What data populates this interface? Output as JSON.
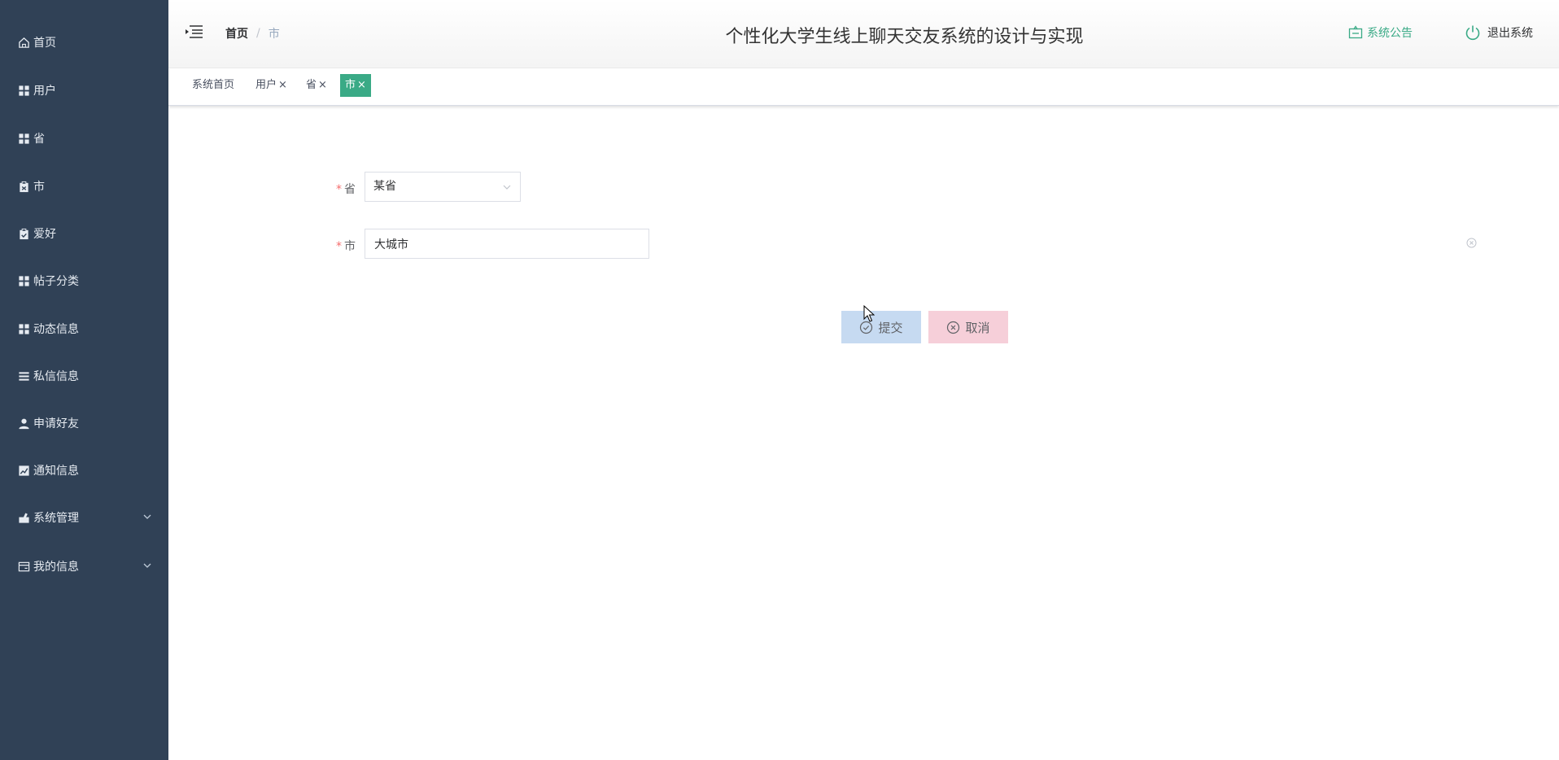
{
  "sidebar": {
    "items": [
      {
        "label": "首页",
        "icon": "home-icon"
      },
      {
        "label": "用户",
        "icon": "grid-icon"
      },
      {
        "label": "省",
        "icon": "grid-icon"
      },
      {
        "label": "市",
        "icon": "clipboard-icon"
      },
      {
        "label": "爱好",
        "icon": "clipboard-check-icon"
      },
      {
        "label": "帖子分类",
        "icon": "grid-icon"
      },
      {
        "label": "动态信息",
        "icon": "grid-icon"
      },
      {
        "label": "私信信息",
        "icon": "list-icon"
      },
      {
        "label": "申请好友",
        "icon": "user-icon"
      },
      {
        "label": "通知信息",
        "icon": "chart-icon"
      },
      {
        "label": "系统管理",
        "icon": "tool-icon"
      },
      {
        "label": "我的信息",
        "icon": "card-icon"
      }
    ]
  },
  "header": {
    "breadcrumb_home": "首页",
    "breadcrumb_sep": "/",
    "breadcrumb_current": "市",
    "title": "个性化大学生线上聊天交友系统的设计与实现",
    "notice_label": "系统公告",
    "logout_label": "退出系统"
  },
  "tags": [
    {
      "label": "系统首页",
      "closable": false,
      "active": false
    },
    {
      "label": "用户",
      "closable": true,
      "active": false
    },
    {
      "label": "省",
      "closable": true,
      "active": false
    },
    {
      "label": "市",
      "closable": true,
      "active": true
    }
  ],
  "tag_close": "×",
  "form": {
    "required_mark": "*",
    "province_label": "省",
    "province_value": "某省",
    "city_label": "市",
    "city_value": "大城市"
  },
  "buttons": {
    "submit": "提交",
    "cancel": "取消"
  },
  "colors": {
    "sidebar_bg": "#304156",
    "accent": "#3aaa86",
    "submit_bg": "#c6daf1",
    "cancel_bg": "#f6cfd9"
  }
}
